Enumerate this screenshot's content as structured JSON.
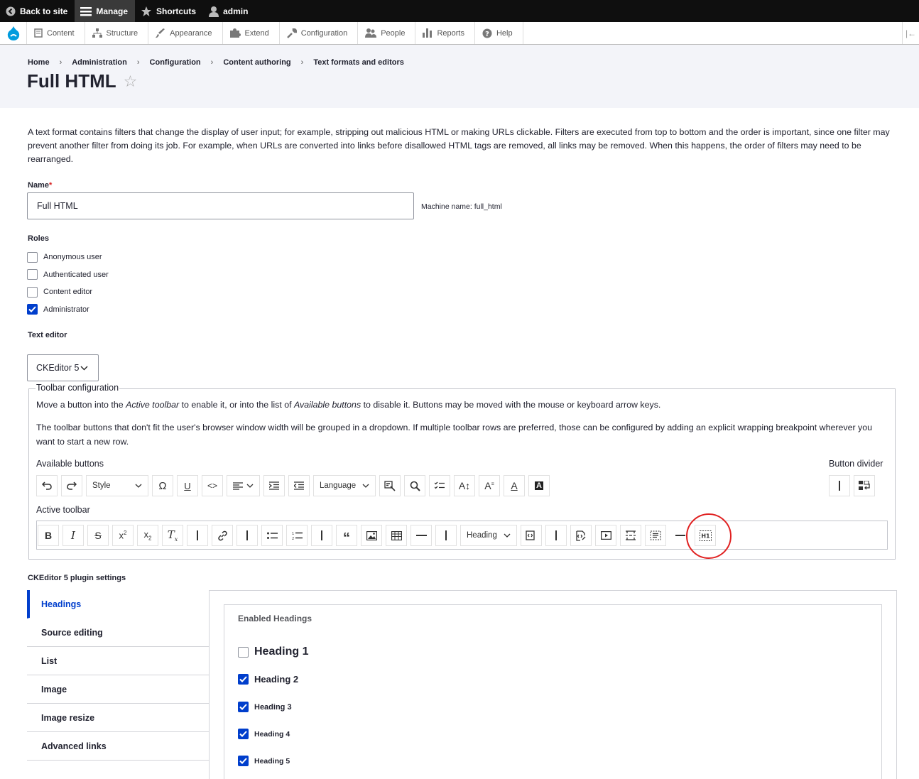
{
  "adminbar": {
    "back": "Back to site",
    "manage": "Manage",
    "shortcuts": "Shortcuts",
    "user": "admin"
  },
  "tray": {
    "items": [
      "Content",
      "Structure",
      "Appearance",
      "Extend",
      "Configuration",
      "People",
      "Reports",
      "Help"
    ]
  },
  "breadcrumb": [
    "Home",
    "Administration",
    "Configuration",
    "Content authoring",
    "Text formats and editors"
  ],
  "page_title": "Full HTML",
  "description": "A text format contains filters that change the display of user input; for example, stripping out malicious HTML or making URLs clickable. Filters are executed from top to bottom and the order is important, since one filter may prevent another filter from doing its job. For example, when URLs are converted into links before disallowed HTML tags are removed, all links may be removed. When this happens, the order of filters may need to be rearranged.",
  "name_field": {
    "label": "Name",
    "required_mark": "*",
    "value": "Full HTML",
    "machine_name": "Machine name: full_html"
  },
  "roles": {
    "label": "Roles",
    "items": [
      {
        "label": "Anonymous user",
        "checked": false
      },
      {
        "label": "Authenticated user",
        "checked": false
      },
      {
        "label": "Content editor",
        "checked": false
      },
      {
        "label": "Administrator",
        "checked": true
      }
    ]
  },
  "text_editor": {
    "label": "Text editor",
    "value": "CKEditor 5"
  },
  "toolbar_config": {
    "legend": "Toolbar configuration",
    "help_pre": "Move a button into the ",
    "help_active": "Active toolbar",
    "help_mid": " to enable it, or into the list of ",
    "help_available": "Available buttons",
    "help_post": " to disable it. Buttons may be moved with the mouse or keyboard arrow keys.",
    "help2": "The toolbar buttons that don't fit the user's browser window width will be grouped in a dropdown. If multiple toolbar rows are preferred, those can be configured by adding an explicit wrapping breakpoint wherever you want to start a new row.",
    "available_label": "Available buttons",
    "divider_label": "Button divider",
    "active_label": "Active toolbar",
    "style_label": "Style",
    "language_label": "Language",
    "heading_label": "Heading"
  },
  "plugin_settings": {
    "title": "CKEditor 5 plugin settings",
    "tabs": [
      "Headings",
      "Source editing",
      "List",
      "Image",
      "Image resize",
      "Advanced links"
    ],
    "pane_title": "Enabled Headings",
    "headings": [
      {
        "label": "Heading 1",
        "checked": false
      },
      {
        "label": "Heading 2",
        "checked": true
      },
      {
        "label": "Heading 3",
        "checked": true
      },
      {
        "label": "Heading 4",
        "checked": true
      },
      {
        "label": "Heading 5",
        "checked": true
      }
    ]
  }
}
